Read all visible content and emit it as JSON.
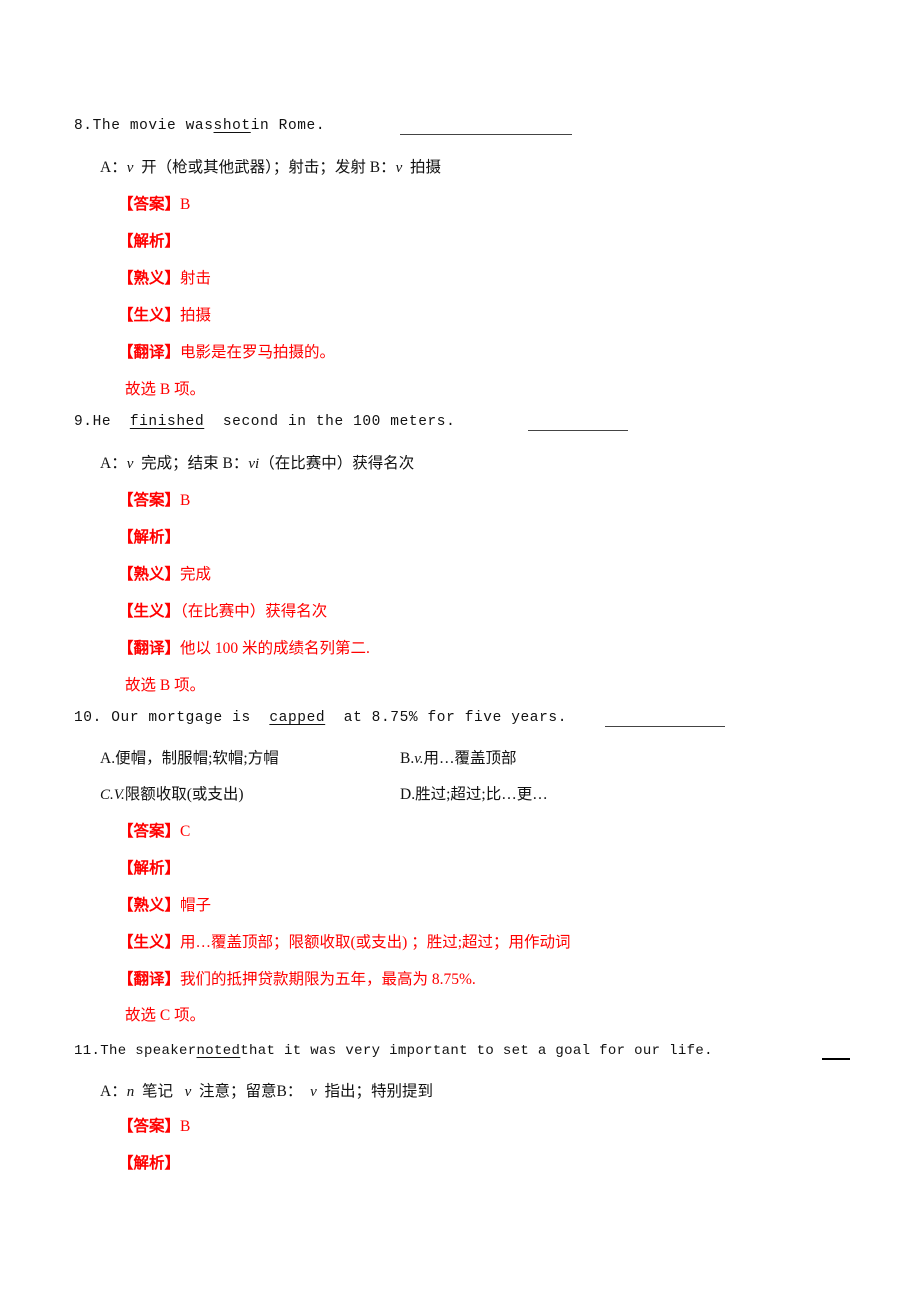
{
  "document": {
    "type": "english-vocabulary-worksheet",
    "accent_color": "#ff0000",
    "text_color": "#111111"
  },
  "questions": [
    {
      "number": "8.",
      "stem_before": "The  movie was",
      "target_word": "shot",
      "stem_after": "in Rome.",
      "options_inline": [
        {
          "letter": "A：",
          "pos": "v",
          "gloss": "开（枪或其他武器）；射击；发射"
        },
        {
          "letter": "B：",
          "pos": "v",
          "gloss": "拍摄"
        }
      ],
      "annotations": {
        "answer_label": "【答案】",
        "answer_value": "B",
        "analysis_label": "【解析】",
        "known_label": "【熟义】",
        "known_value": "射击",
        "new_label": "【生义】",
        "new_value": "拍摄",
        "translation_label": "【翻译】",
        "translation_value": "电影是在罗马拍摄的。",
        "conclusion": "故选 B 项。"
      }
    },
    {
      "number": "9.",
      "stem_before": "He",
      "target_word": "finished",
      "stem_after": "second in the 100 meters.",
      "options_inline": [
        {
          "letter": "A：",
          "pos": "v",
          "gloss": "完成；结束"
        },
        {
          "letter": "B：",
          "pos": "vi",
          "gloss": "（在比赛中）获得名次"
        }
      ],
      "annotations": {
        "answer_label": "【答案】",
        "answer_value": "B",
        "analysis_label": "【解析】",
        "known_label": "【熟义】",
        "known_value": "完成",
        "new_label": "【生义】",
        "new_value": "（在比赛中）获得名次",
        "translation_label": "【翻译】",
        "translation_value": "他以 100 米的成绩名列第二.",
        "conclusion": "故选 B 项。"
      }
    },
    {
      "number": "10.",
      "stem_before": "Our mortgage is",
      "target_word": "capped",
      "stem_after": "at 8.75% for five years.",
      "options_grid": [
        {
          "letter": "A.",
          "pos": "",
          "gloss": "便帽，制服帽;软帽;方帽"
        },
        {
          "letter": "B.",
          "pos": "v.",
          "gloss": "用…覆盖顶部"
        },
        {
          "letter": "C.",
          "pos": "V.",
          "gloss": "限额收取(或支出)"
        },
        {
          "letter": "D.",
          "pos": "",
          "gloss": "胜过;超过;比…更…"
        }
      ],
      "annotations": {
        "answer_label": "【答案】",
        "answer_value": "C",
        "analysis_label": "【解析】",
        "known_label": "【熟义】",
        "known_value": "帽子",
        "new_label": "【生义】",
        "new_value": "用…覆盖顶部；限额收取(或支出) ；胜过;超过；用作动词",
        "translation_label": "【翻译】",
        "translation_value": "我们的抵押贷款期限为五年，最高为 8.75%.",
        "conclusion": "故选 C 项。"
      }
    },
    {
      "number": "11.",
      "stem_before": "The speaker",
      "target_word": "noted",
      "stem_after": "that it was very important to set a goal for our life.",
      "options_inline": [
        {
          "letter": "A：",
          "pos": "n",
          "gloss": "笔记"
        },
        {
          "letter": "",
          "pos": "v",
          "gloss": "注意；留意"
        },
        {
          "letter": "B：",
          "pos": "v",
          "gloss": "指出；特别提到"
        }
      ],
      "annotations": {
        "answer_label": "【答案】",
        "answer_value": "B",
        "analysis_label": "【解析】"
      }
    }
  ]
}
